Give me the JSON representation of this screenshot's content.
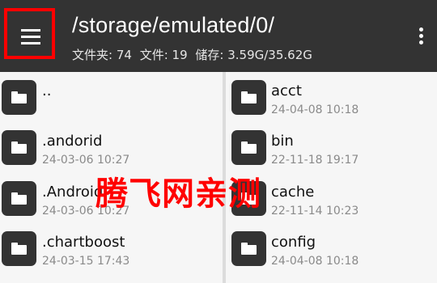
{
  "header": {
    "path": "/storage/emulated/0/",
    "stats": {
      "folders": "文件夹: 74",
      "files": "文件: 19",
      "storage": "储存: 3.59G/35.62G"
    },
    "menu_icon": "hamburger-menu-icon",
    "more_icon": "vertical-dots-icon"
  },
  "left_items": [
    {
      "name": "..",
      "date": ""
    },
    {
      "name": ".andorid",
      "date": "24-03-06 10:27"
    },
    {
      "name": ".Android",
      "date": "24-03-06 10:27"
    },
    {
      "name": ".chartboost",
      "date": "24-03-15 17:43"
    }
  ],
  "right_items": [
    {
      "name": "acct",
      "date": "24-04-08 10:18"
    },
    {
      "name": "bin",
      "date": "22-11-18 19:17"
    },
    {
      "name": "cache",
      "date": "22-11-14 10:23"
    },
    {
      "name": "config",
      "date": "24-04-08 10:18"
    }
  ],
  "watermark": "腾飞网亲测",
  "colors": {
    "appbar": "#333333",
    "highlight": "#ff0000",
    "folder_icon": "#333333"
  }
}
